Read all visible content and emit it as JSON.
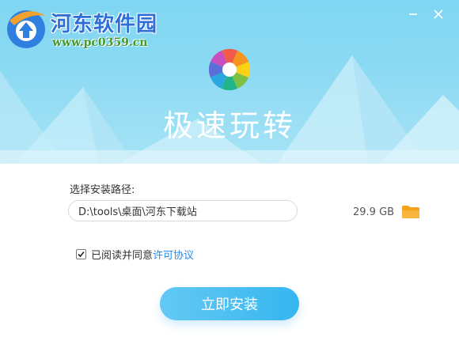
{
  "watermark": {
    "title": "河东软件园",
    "url": "www.pc0359.cn"
  },
  "window_controls": {
    "minimize_icon": "minimize-icon",
    "close_icon": "close-icon"
  },
  "app": {
    "title": "极速玩转",
    "logo_icon": "app-logo-icon"
  },
  "install": {
    "path_label": "选择安装路径:",
    "path_value": "D:\\tools\\桌面\\河东下载站",
    "disk_space": "29.9 GB",
    "folder_icon": "folder-icon",
    "agree_checked": true,
    "agree_text": "已阅读并同意",
    "license_link": "许可协议",
    "install_button": "立即安装"
  },
  "colors": {
    "header_sky": "#8ddaf3",
    "accent": "#36b6f0",
    "link": "#2a8be6",
    "folder": "#f4a31b"
  }
}
